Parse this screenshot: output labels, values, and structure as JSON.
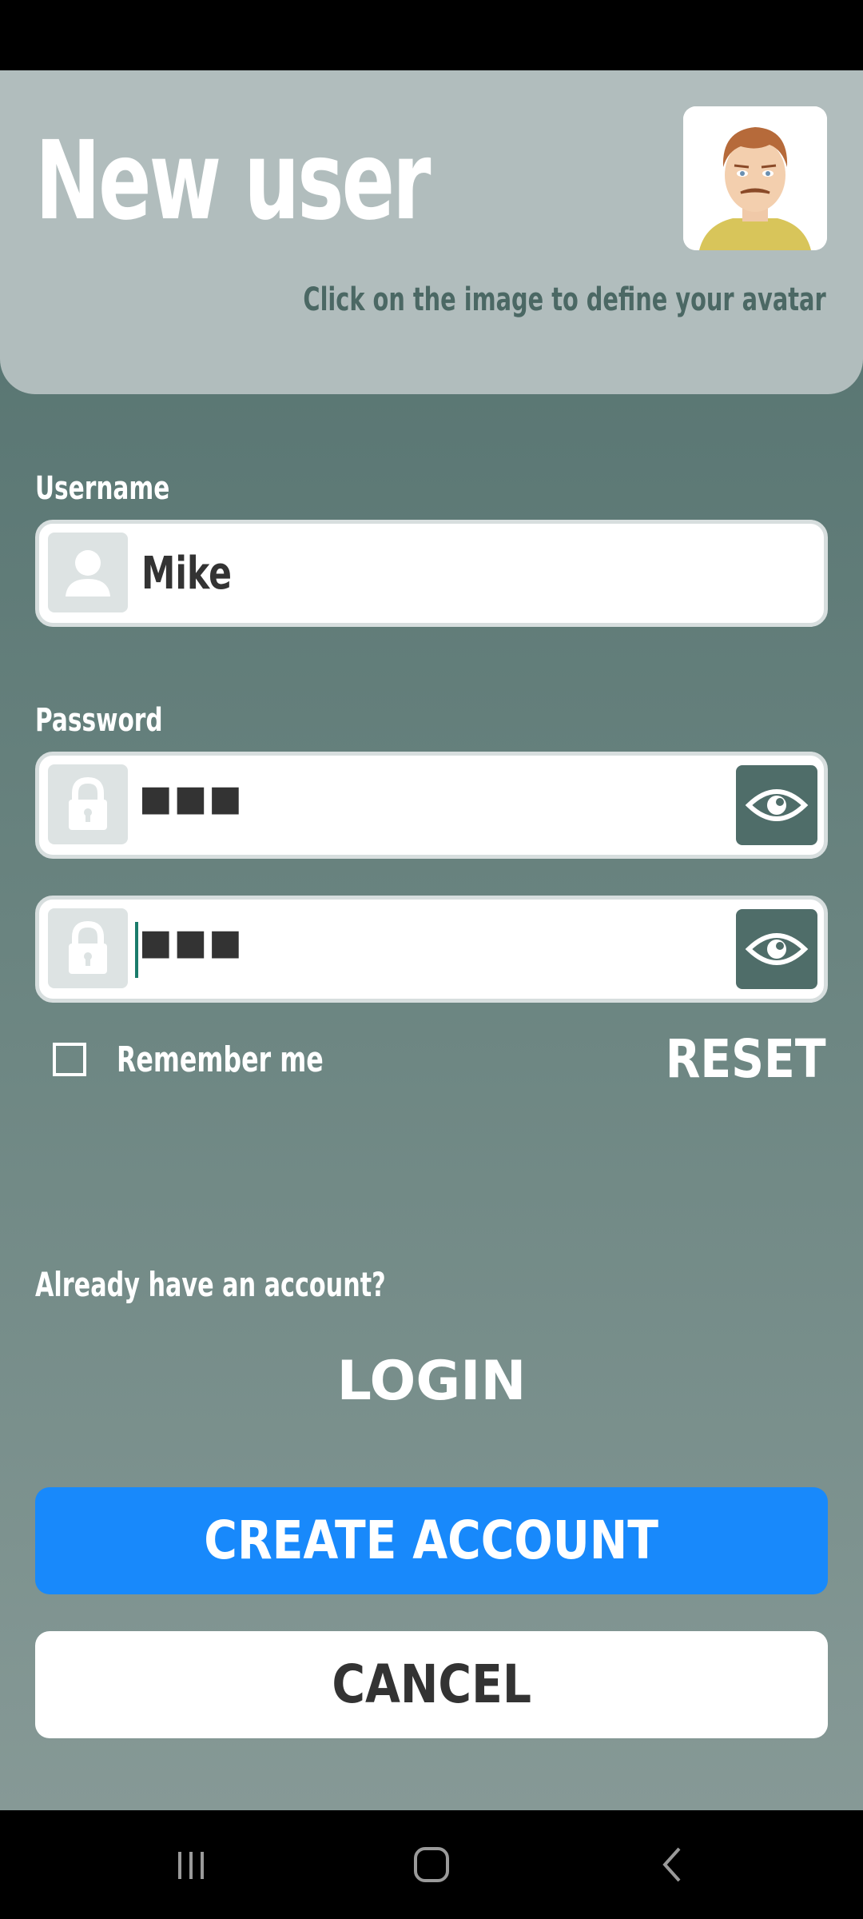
{
  "header": {
    "title": "New user",
    "avatar_hint": "Click on the image to define your avatar"
  },
  "form": {
    "username_label": "Username",
    "username_value": "Mike",
    "password_label": "Password",
    "password_mask": "■■■",
    "confirm_mask": "■■■",
    "remember_label": "Remember me",
    "reset_label": "RESET"
  },
  "footer": {
    "already_text": "Already have an account?",
    "login_label": "LOGIN",
    "create_label": "CREATE ACCOUNT",
    "cancel_label": "CANCEL"
  },
  "colors": {
    "accent": "#1889fb",
    "header_bg": "#b1bdbd",
    "eye_button": "#4f6d69"
  },
  "icons": [
    "user-silhouette-icon",
    "lock-icon",
    "eye-icon",
    "recent-apps-icon",
    "home-icon",
    "back-icon"
  ]
}
